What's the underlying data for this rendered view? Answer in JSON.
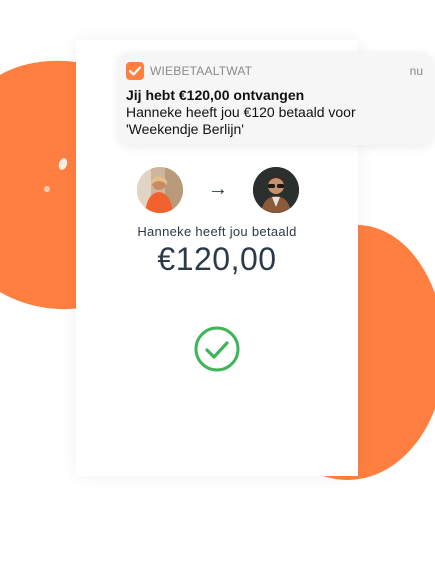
{
  "notification": {
    "app_name": "WIEBETAALTWAT",
    "time": "nu",
    "title": "Jij hebt €120,00 ontvangen",
    "body": "Hanneke heeft jou €120 betaald voor 'Weekendje Berlijn'"
  },
  "payment": {
    "arrow": "→",
    "paid_label": "Hanneke heeft jou betaald",
    "amount": "€120,00"
  },
  "colors": {
    "accent": "#ff7f40",
    "text": "#2c3a4a",
    "success": "#3fb55a"
  },
  "icons": {
    "app": "wiebetaaltwat-check-icon",
    "success": "success-check-icon",
    "arrow": "arrow-right-icon"
  }
}
